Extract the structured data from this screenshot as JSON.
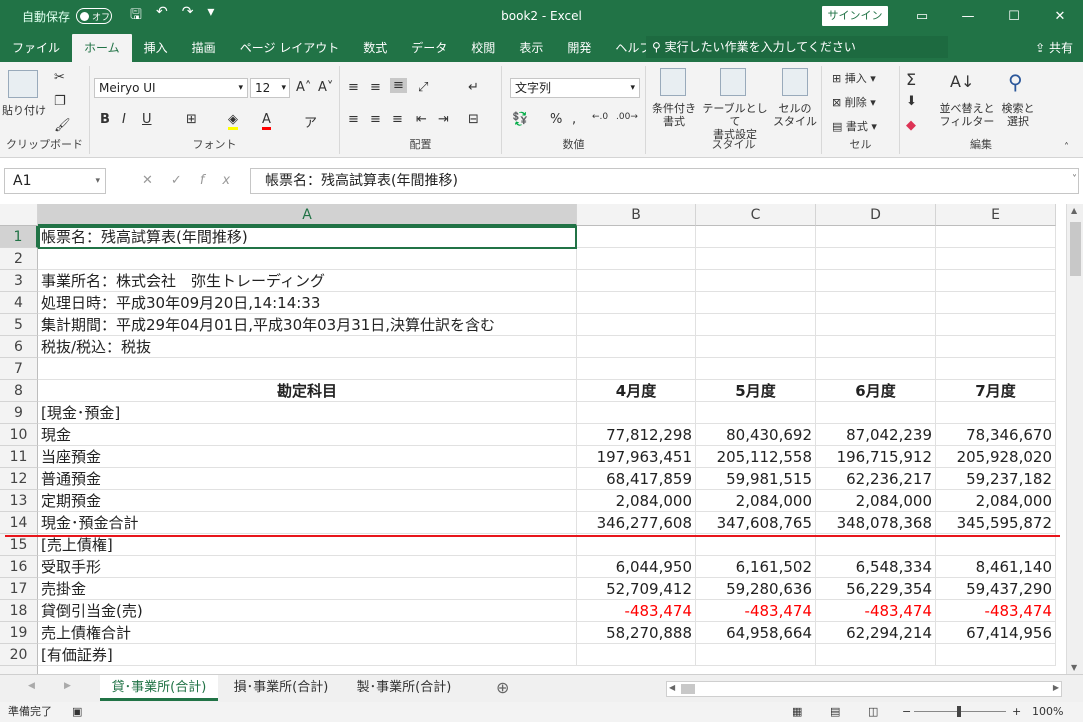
{
  "titlebar": {
    "autosave_label": "自動保存",
    "autosave_state": "オフ",
    "title": "book2  -  Excel",
    "signin": "サインイン"
  },
  "tabs": [
    "ファイル",
    "ホーム",
    "挿入",
    "描画",
    "ページ レイアウト",
    "数式",
    "データ",
    "校閲",
    "表示",
    "開発",
    "ヘルプ"
  ],
  "active_tab": "ホーム",
  "tellme": "実行したい作業を入力してください",
  "share": "共有",
  "ribbon": {
    "clipboard": {
      "label": "クリップボード",
      "paste": "貼り付け"
    },
    "font": {
      "label": "フォント",
      "family": "Meiryo UI",
      "size": "12"
    },
    "alignment": {
      "label": "配置"
    },
    "number": {
      "label": "数値",
      "format": "文字列"
    },
    "styles": {
      "label": "スタイル",
      "cond_format": "条件付き\n書式",
      "table_format": "テーブルとして\n書式設定",
      "cell_style": "セルの\nスタイル"
    },
    "cells": {
      "label": "セル",
      "insert": "挿入",
      "delete": "削除",
      "format": "書式"
    },
    "editing": {
      "label": "編集",
      "sort": "並べ替えと\nフィルター",
      "find": "検索と\n選択"
    }
  },
  "formula_bar": {
    "namebox": "A1",
    "formula": "帳票名：残高試算表(年間推移)"
  },
  "columns": [
    "A",
    "B",
    "C",
    "D",
    "E"
  ],
  "rows": [
    {
      "n": "1",
      "a": "帳票名：残高試算表(年間推移)",
      "v": []
    },
    {
      "n": "2",
      "a": "",
      "v": []
    },
    {
      "n": "3",
      "a": "事業所名：株式会社　弥生トレーディング",
      "v": []
    },
    {
      "n": "4",
      "a": "処理日時：平成30年09月20日,14:14:33",
      "v": []
    },
    {
      "n": "5",
      "a": "集計期間：平成29年04月01日,平成30年03月31日,決算仕訳を含む",
      "v": []
    },
    {
      "n": "6",
      "a": "税抜/税込：税抜",
      "v": []
    },
    {
      "n": "7",
      "a": "",
      "v": []
    },
    {
      "n": "8",
      "a": "勘定科目",
      "v": [
        "4月度",
        "5月度",
        "6月度",
        "7月度"
      ],
      "header": true
    },
    {
      "n": "9",
      "a": "[現金･預金]",
      "v": []
    },
    {
      "n": "10",
      "a": "現金",
      "v": [
        "77,812,298",
        "80,430,692",
        "87,042,239",
        "78,346,670"
      ]
    },
    {
      "n": "11",
      "a": "当座預金",
      "v": [
        "197,963,451",
        "205,112,558",
        "196,715,912",
        "205,928,020"
      ]
    },
    {
      "n": "12",
      "a": "普通預金",
      "v": [
        "68,417,859",
        "59,981,515",
        "62,236,217",
        "59,237,182"
      ]
    },
    {
      "n": "13",
      "a": "定期預金",
      "v": [
        "2,084,000",
        "2,084,000",
        "2,084,000",
        "2,084,000"
      ]
    },
    {
      "n": "14",
      "a": "現金･預金合計",
      "v": [
        "346,277,608",
        "347,608,765",
        "348,078,368",
        "345,595,872"
      ]
    },
    {
      "n": "15",
      "a": "[売上債権]",
      "v": []
    },
    {
      "n": "16",
      "a": "受取手形",
      "v": [
        "6,044,950",
        "6,161,502",
        "6,548,334",
        "8,461,140"
      ]
    },
    {
      "n": "17",
      "a": "売掛金",
      "v": [
        "52,709,412",
        "59,280,636",
        "56,229,354",
        "59,437,290"
      ]
    },
    {
      "n": "18",
      "a": "貸倒引当金(売)",
      "v": [
        "-483,474",
        "-483,474",
        "-483,474",
        "-483,474"
      ],
      "negative": true
    },
    {
      "n": "19",
      "a": "売上債権合計",
      "v": [
        "58,270,888",
        "64,958,664",
        "62,294,214",
        "67,414,956"
      ]
    },
    {
      "n": "20",
      "a": "[有価証券]",
      "v": []
    }
  ],
  "sheets": [
    "貸･事業所(合計)",
    "損･事業所(合計)",
    "製･事業所(合計)"
  ],
  "status": {
    "ready": "準備完了",
    "zoom": "100%"
  }
}
